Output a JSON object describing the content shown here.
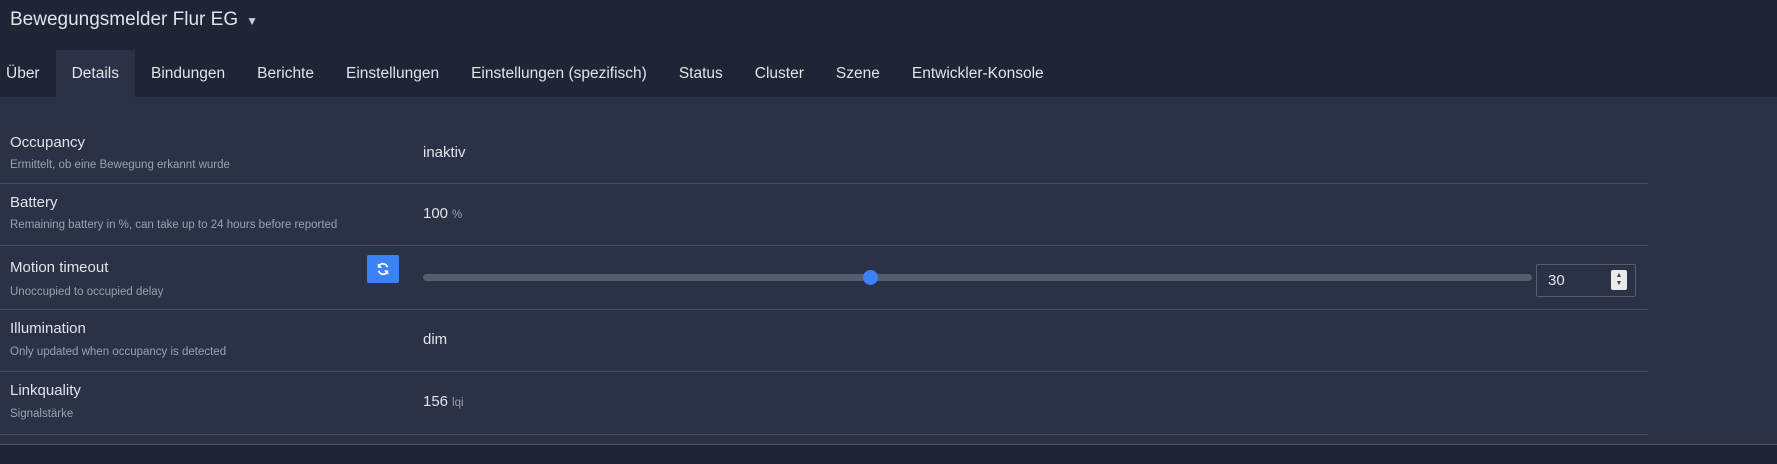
{
  "header": {
    "device_name": "Bewegungsmelder Flur EG",
    "caret_icon": "chevron-down-icon"
  },
  "tabs": [
    {
      "label": "Über"
    },
    {
      "label": "Details",
      "active": true
    },
    {
      "label": "Bindungen"
    },
    {
      "label": "Berichte"
    },
    {
      "label": "Einstellungen"
    },
    {
      "label": "Einstellungen (spezifisch)"
    },
    {
      "label": "Status"
    },
    {
      "label": "Cluster"
    },
    {
      "label": "Szene"
    },
    {
      "label": "Entwickler-Konsole"
    }
  ],
  "details": {
    "occupancy": {
      "label": "Occupancy",
      "description": "Ermittelt, ob eine Bewegung erkannt wurde",
      "value": "inaktiv"
    },
    "battery": {
      "label": "Battery",
      "description": "Remaining battery in %, can take up to 24 hours before reported",
      "value": "100",
      "unit": "%"
    },
    "motion_timeout": {
      "label": "Motion timeout",
      "description": "Unoccupied to occupied delay",
      "value": "30",
      "slider_fraction": 0.403,
      "refresh_icon": "refresh-icon"
    },
    "illumination": {
      "label": "Illumination",
      "description": "Only updated when occupancy is detected",
      "value": "dim"
    },
    "linkquality": {
      "label": "Linkquality",
      "description": "Signalstärke",
      "value": "156",
      "unit": "lqi"
    }
  },
  "colors": {
    "accent": "#3b82f6",
    "background": "#1f2534",
    "panel": "#2b3246"
  }
}
